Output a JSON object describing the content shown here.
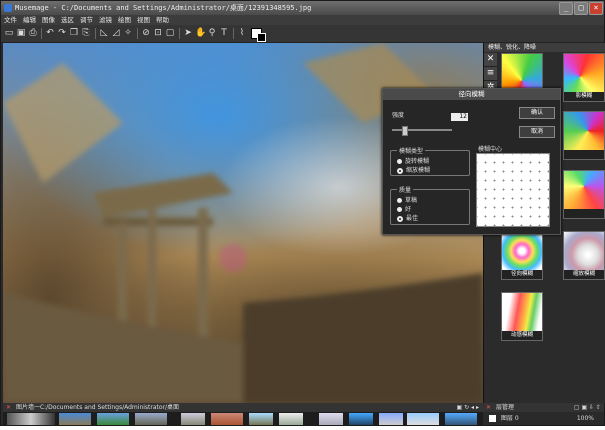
{
  "window": {
    "title": "Musemage - C:/Documents and Settings/Administrator/桌面/12391348595.jpg",
    "minimize": "_",
    "maximize": "□",
    "close": "×"
  },
  "menu": [
    "文件",
    "编辑",
    "图像",
    "选区",
    "调节",
    "滤镜",
    "绘图",
    "视图",
    "帮助"
  ],
  "right_panel": {
    "header": "模糊、锐化、降噪",
    "presets": [
      {
        "label": ""
      },
      {
        "label": "影模糊"
      },
      {
        "label": ""
      },
      {
        "label": ""
      },
      {
        "label": "径向模糊"
      },
      {
        "label": "缩放模糊"
      },
      {
        "label": "动感模糊"
      }
    ]
  },
  "dialog": {
    "title": "径向模糊",
    "strength_label": "强度",
    "strength_value": "12",
    "strength_fraction": 0.2,
    "ok": "确认",
    "cancel": "取消",
    "blur_type_label": "模糊类型",
    "blur_types": [
      "旋转模糊",
      "缩放模糊"
    ],
    "blur_type_selected": 1,
    "center_label": "模糊中心",
    "quality_label": "质量",
    "qualities": [
      "草稿",
      "好",
      "最佳"
    ],
    "quality_selected": 2
  },
  "filmstrip": {
    "path": "图片墙一C:/Documents and Settings/Administrator/桌面"
  },
  "layers": {
    "header": "层管理",
    "layer_name": "图层 0",
    "opacity": "100%"
  }
}
